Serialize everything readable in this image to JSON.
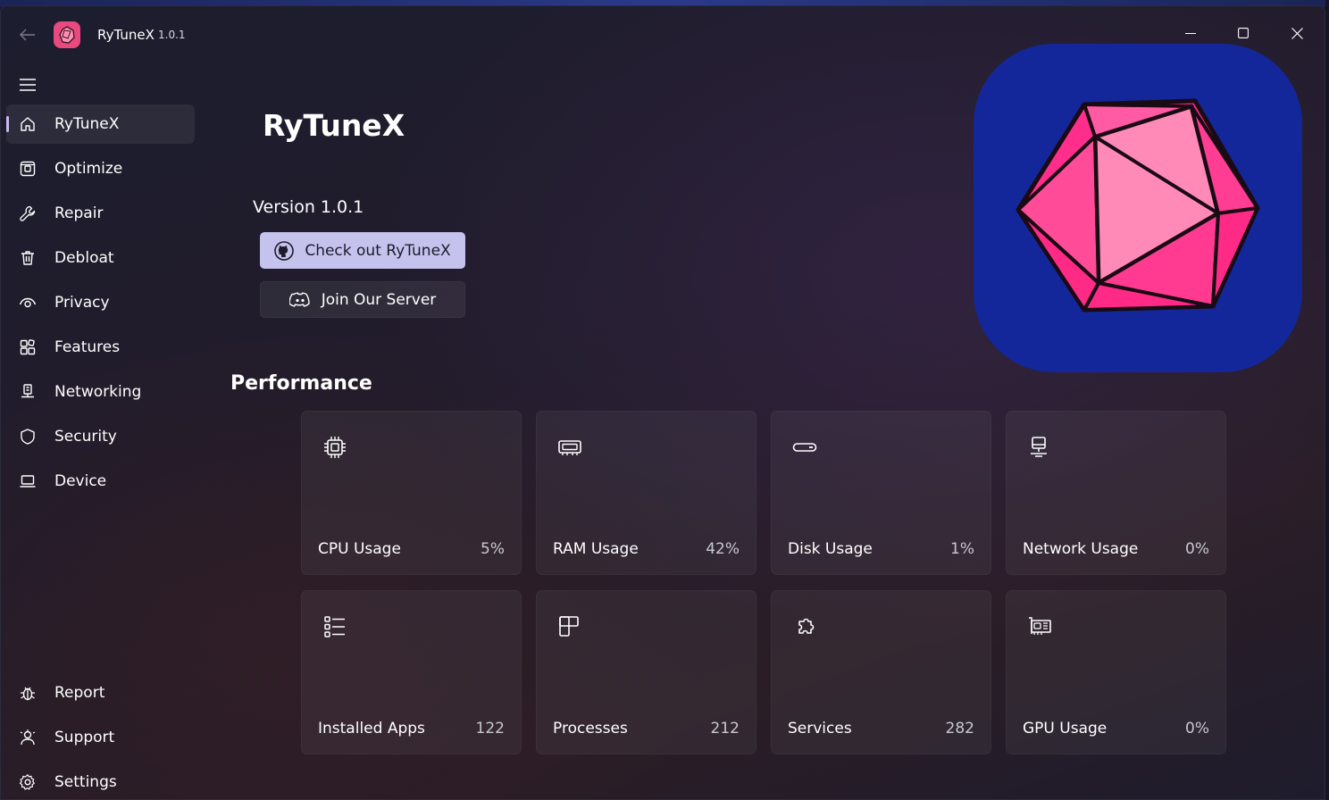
{
  "titlebar": {
    "app_name": "RyTuneX",
    "app_version": "1.0.1"
  },
  "sidebar": {
    "top_items": [
      {
        "label": "RyTuneX",
        "icon": "home-icon",
        "selected": true
      },
      {
        "label": "Optimize",
        "icon": "optimize-icon"
      },
      {
        "label": "Repair",
        "icon": "wrench-icon"
      },
      {
        "label": "Debloat",
        "icon": "trash-icon"
      },
      {
        "label": "Privacy",
        "icon": "eye-icon"
      },
      {
        "label": "Features",
        "icon": "features-icon"
      },
      {
        "label": "Networking",
        "icon": "network-icon"
      },
      {
        "label": "Security",
        "icon": "shield-icon"
      },
      {
        "label": "Device",
        "icon": "laptop-icon"
      }
    ],
    "bottom_items": [
      {
        "label": "Report",
        "icon": "bug-icon"
      },
      {
        "label": "Support",
        "icon": "support-icon"
      },
      {
        "label": "Settings",
        "icon": "gear-icon"
      }
    ]
  },
  "main": {
    "title": "RyTuneX",
    "version_text": "Version 1.0.1",
    "primary_button": "Check out RyTuneX",
    "secondary_button": "Join Our Server",
    "performance_title": "Performance",
    "cards": [
      {
        "label": "CPU Usage",
        "value": "5%",
        "icon": "cpu-icon"
      },
      {
        "label": "RAM Usage",
        "value": "42%",
        "icon": "ram-icon"
      },
      {
        "label": "Disk Usage",
        "value": "1%",
        "icon": "disk-icon"
      },
      {
        "label": "Network Usage",
        "value": "0%",
        "icon": "network-usage-icon"
      },
      {
        "label": "Installed Apps",
        "value": "122",
        "icon": "list-icon"
      },
      {
        "label": "Processes",
        "value": "212",
        "icon": "processes-icon"
      },
      {
        "label": "Services",
        "value": "282",
        "icon": "puzzle-icon"
      },
      {
        "label": "GPU Usage",
        "value": "0%",
        "icon": "gpu-icon"
      }
    ]
  },
  "colors": {
    "accent": "#c5c3ee",
    "logo_pink": "#e8497e",
    "hero_blue": "#13279a"
  }
}
